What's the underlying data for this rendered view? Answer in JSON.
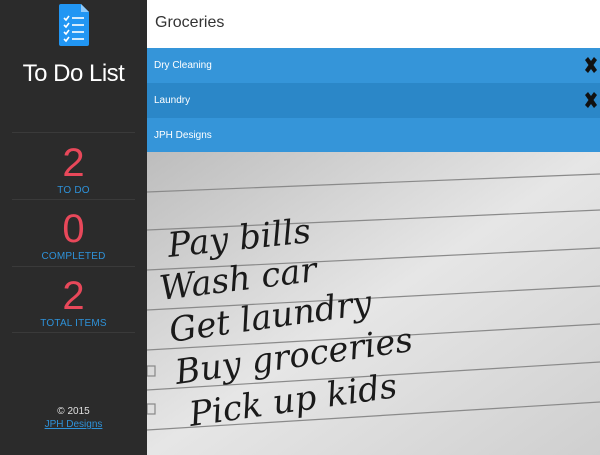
{
  "app": {
    "title": "To Do List"
  },
  "stats": {
    "todo": {
      "value": "2",
      "label": "TO DO"
    },
    "completed": {
      "value": "0",
      "label": "COMPLETED"
    },
    "total": {
      "value": "2",
      "label": "TOTAL ITEMS"
    }
  },
  "footer": {
    "copyright": "© 2015",
    "link": "JPH Designs"
  },
  "input": {
    "value": "Groceries"
  },
  "items": [
    {
      "text": "Dry Cleaning",
      "deletable": true,
      "color": "#3595d9"
    },
    {
      "text": "Laundry",
      "deletable": true,
      "color": "#2b87c8"
    },
    {
      "text": "JPH Designs",
      "deletable": false,
      "color": "#3595d9"
    }
  ],
  "photo": {
    "handwritten": [
      "Pay bills",
      "Wash car",
      "Get laundry",
      "Buy groceries",
      "Pick up kids"
    ]
  },
  "colors": {
    "accent_blue": "#2e92d9",
    "stat_red": "#e8485a",
    "sidebar": "#2b2b2b"
  },
  "icons": {
    "app": "checklist-icon",
    "delete": "close-icon"
  }
}
